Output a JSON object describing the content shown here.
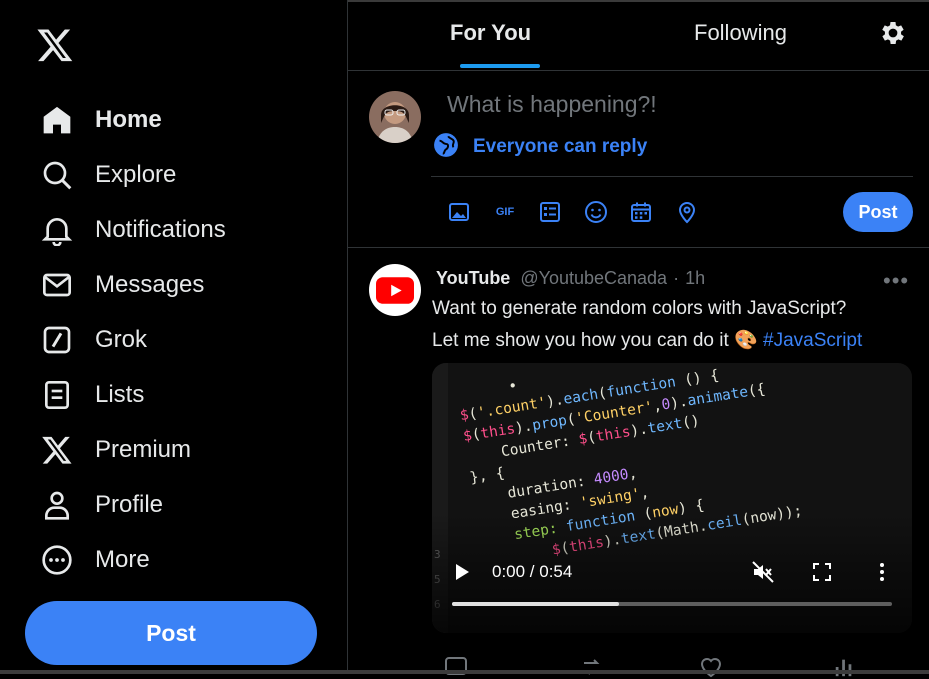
{
  "colors": {
    "accent": "#3b82f6",
    "background": "#000000",
    "muted": "#71767b",
    "text": "#e7e9ea"
  },
  "sidebar": {
    "logo_icon": "x-logo-icon",
    "items": [
      {
        "label": "Home",
        "icon": "home-icon",
        "active": true
      },
      {
        "label": "Explore",
        "icon": "search-icon"
      },
      {
        "label": "Notifications",
        "icon": "bell-icon"
      },
      {
        "label": "Messages",
        "icon": "envelope-icon"
      },
      {
        "label": "Grok",
        "icon": "grok-icon"
      },
      {
        "label": "Lists",
        "icon": "list-icon"
      },
      {
        "label": "Premium",
        "icon": "x-logo-icon"
      },
      {
        "label": "Profile",
        "icon": "person-icon"
      },
      {
        "label": "More",
        "icon": "more-circle-icon"
      }
    ],
    "post_label": "Post"
  },
  "tabs": {
    "for_you": "For You",
    "following": "Following",
    "settings_icon": "gear-icon"
  },
  "composer": {
    "placeholder": "What is happening?!",
    "reply_setting": "Everyone can reply",
    "tools": [
      "image-icon",
      "gif-icon",
      "poll-icon",
      "emoji-icon",
      "schedule-icon",
      "location-icon"
    ],
    "gif_label": "GIF",
    "post_label": "Post"
  },
  "tweet": {
    "name": "YouTube",
    "handle": "@YoutubeCanada",
    "separator": "·",
    "time": "1h",
    "more": "•••",
    "line1": "Want to generate random colors with JavaScript?",
    "line2_text": "Let me show you how you can do it 🎨",
    "hashtag": "#JavaScript",
    "video": {
      "time": "0:00 / 0:54",
      "progress": 0.38,
      "muted": true
    }
  }
}
